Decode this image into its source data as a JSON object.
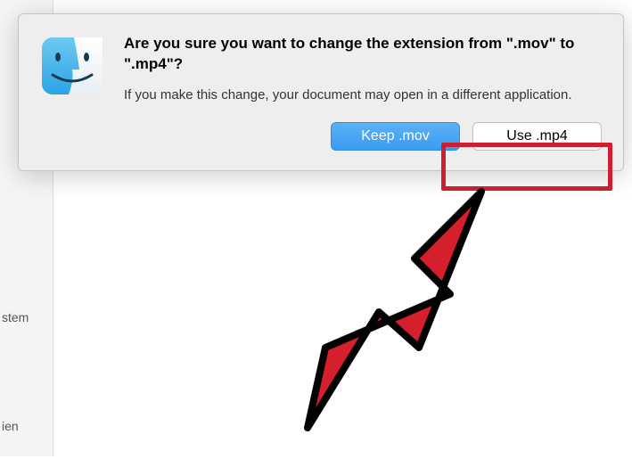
{
  "dialog": {
    "title": "Are you sure you want to change the extension from \".mov\" to \".mp4\"?",
    "message": "If you make this change, your document may open in a different application.",
    "buttons": {
      "keep": "Keep .mov",
      "use": "Use .mp4"
    }
  },
  "sidebar": {
    "item1": "stem",
    "item2": "ien"
  }
}
